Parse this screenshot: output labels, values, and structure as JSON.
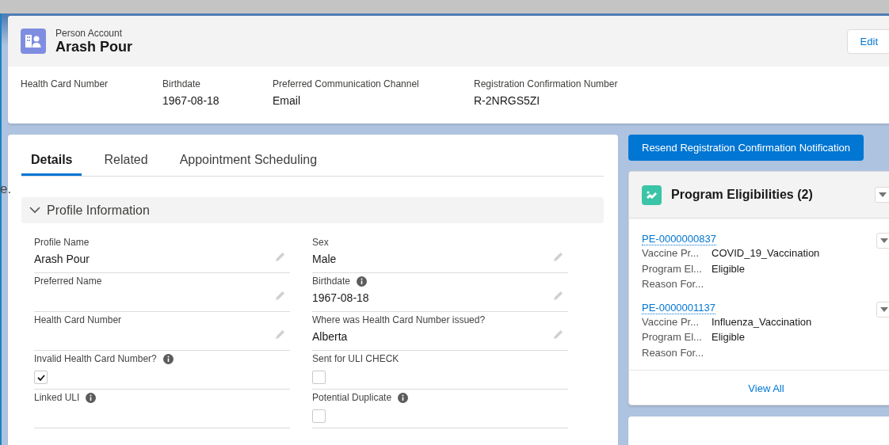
{
  "stray_text": "e.",
  "header": {
    "object_type": "Person Account",
    "title": "Arash Pour",
    "edit_button": "Edit",
    "highlights": [
      {
        "label": "Health Card Number"
      },
      {
        "label": "Birthdate",
        "value": "1967-08-18"
      },
      {
        "label": "Preferred Communication Channel",
        "value": "Email"
      },
      {
        "label": "Registration Confirmation Number",
        "value": "R-2NRGS5ZI"
      }
    ]
  },
  "tabs": [
    {
      "label": "Details",
      "selected": true
    },
    {
      "label": "Related",
      "selected": false
    },
    {
      "label": "Appointment Scheduling",
      "selected": false
    }
  ],
  "section": {
    "title": "Profile Information",
    "expanded": true,
    "fields": [
      {
        "kind": "text",
        "label": "Profile Name",
        "value": "Arash Pour",
        "info": false,
        "editable": true
      },
      {
        "kind": "text",
        "label": "Sex",
        "value": "Male",
        "info": false,
        "editable": true
      },
      {
        "kind": "text",
        "label": "Preferred Name",
        "info": false,
        "editable": true
      },
      {
        "kind": "text",
        "label": "Birthdate",
        "value": "1967-08-18",
        "info": true,
        "editable": true
      },
      {
        "kind": "text",
        "label": "Health Card Number",
        "info": false,
        "editable": true
      },
      {
        "kind": "text",
        "label": "Where was Health Card Number issued?",
        "value": "Alberta",
        "info": false,
        "editable": true
      },
      {
        "kind": "checkbox",
        "label": "Invalid Health Card Number?",
        "checked": true,
        "info": true,
        "editable": false
      },
      {
        "kind": "checkbox",
        "label": "Sent for ULI CHECK",
        "checked": false,
        "info": false,
        "editable": false
      },
      {
        "kind": "text",
        "label": "Linked ULI",
        "info": true,
        "editable": false
      },
      {
        "kind": "checkbox",
        "label": "Potential Duplicate",
        "checked": false,
        "info": true,
        "editable": false
      }
    ]
  },
  "action_button": "Resend Registration Confirmation Notification",
  "related_card": {
    "title": "Program Eligibilities (2)",
    "footer_link": "View All",
    "records": [
      {
        "name": "PE-0000000837",
        "fields": [
          {
            "label": "Vaccine Pr...",
            "value": "COVID_19_Vaccination"
          },
          {
            "label": "Program El...",
            "value": "Eligible"
          },
          {
            "label": "Reason For..."
          }
        ]
      },
      {
        "name": "PE-0000001137",
        "fields": [
          {
            "label": "Vaccine Pr...",
            "value": "Influenza_Vaccination"
          },
          {
            "label": "Program El...",
            "value": "Eligible"
          },
          {
            "label": "Reason For..."
          }
        ]
      }
    ]
  }
}
